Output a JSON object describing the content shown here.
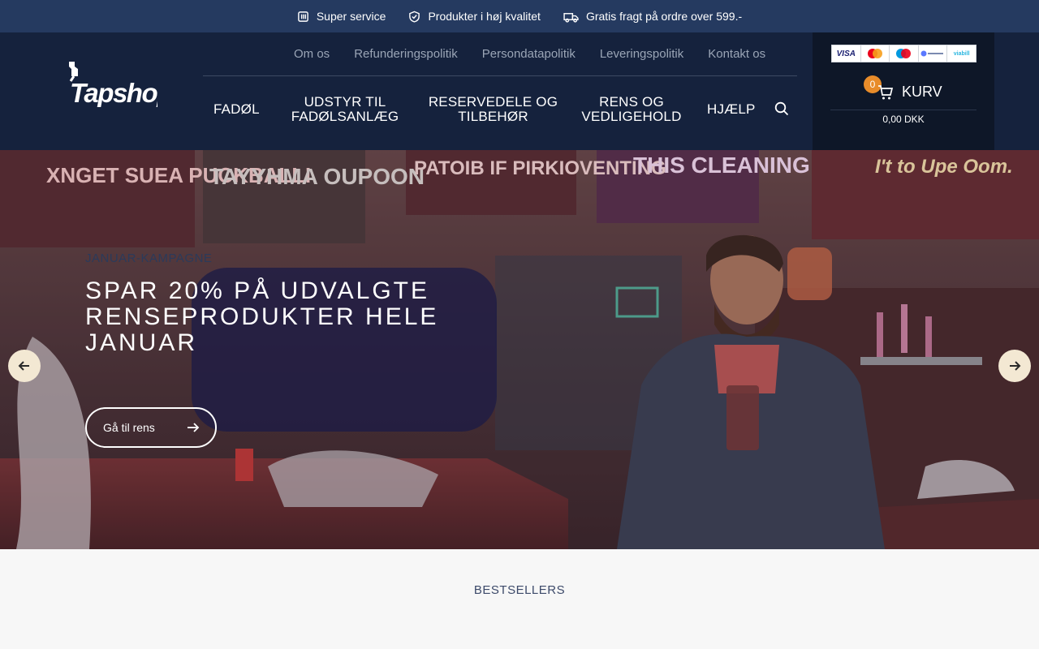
{
  "topbar": {
    "usps": [
      {
        "icon": "service-icon",
        "label": "Super service"
      },
      {
        "icon": "shield-check-icon",
        "label": "Produkter i høj kvalitet"
      },
      {
        "icon": "truck-icon",
        "label": "Gratis fragt på ordre over 599.-"
      }
    ]
  },
  "header": {
    "logo_text": "Tapshop",
    "top_links": [
      "Om os",
      "Refunderingspolitik",
      "Persondatapolitik",
      "Leveringspolitik",
      "Kontakt os"
    ],
    "main_nav": [
      "FADØL",
      "UDSTYR TIL FADØLSANLÆG",
      "RESERVEDELE OG TILBEHØR",
      "RENS OG VEDLIGEHOLD",
      "HJÆLP"
    ],
    "search_icon": "search-icon"
  },
  "cart": {
    "payment_cards": [
      "VISA",
      "mastercard",
      "maestro",
      "mobilepay",
      "viabill"
    ],
    "count": "0",
    "label": "KURV",
    "total": "0,00 DKK"
  },
  "hero": {
    "eyebrow": "JANUAR-KAMPAGNE",
    "headline": "SPAR 20% PÅ UDVALGTE RENSEPRODUKTER HELE JANUAR",
    "cta_label": "Gå til rens",
    "background_signs": [
      "XNGET SUEA PUCKBALL!",
      "TAYYHMA OUPOON",
      "PATOIB IF PIRKIOVENTING",
      "THIS CLEANING",
      "I't to Upe Oom."
    ]
  },
  "section": {
    "bestsellers_title": "BESTSELLERS"
  },
  "colors": {
    "topbar_bg": "#253a60",
    "header_bg": "#15223d",
    "cart_bg": "#0e1728",
    "badge": "#e88c2a",
    "arrow_btn": "#f3e8d3"
  }
}
